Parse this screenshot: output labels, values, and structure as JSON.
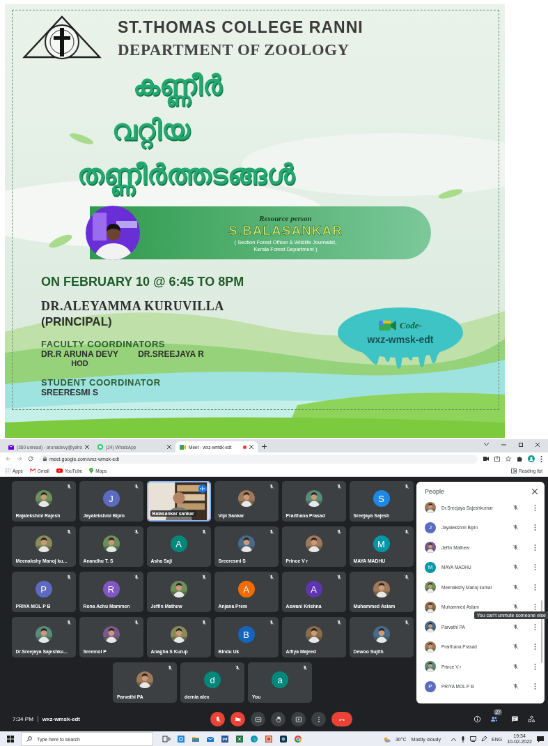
{
  "poster": {
    "college": "ST.THOMAS COLLEGE RANNI",
    "department": "DEPARTMENT OF ZOOLOGY",
    "title_lines": [
      "കണ്ണീർ",
      "വറ്റിയ",
      "തണ്ണീർത്തടങ്ങൾ"
    ],
    "resource_label": "Resource person",
    "speaker": "S.BALASANKAR",
    "speaker_role_lines": [
      "( Section Forest Officer & Wildlife Journalist,",
      "Kerala Forest Department )"
    ],
    "date": "ON FEBRUARY 10 @ 6:45 TO 8PM",
    "principal": "DR.ALEYAMMA KURUVILLA",
    "principal_role": "(PRINCIPAL)",
    "faculty_heading": "FACULTY COORDINATORS",
    "faculty": [
      {
        "name": "DR.R ARUNA DEVY",
        "role": "HOD"
      },
      {
        "name": "DR.SREEJAYA R"
      }
    ],
    "student_heading": "STUDENT COORDINATOR",
    "student": "SREERESMI S",
    "code_label": "Code-",
    "code": "wxz-wmsk-edt"
  },
  "browser": {
    "tabs": [
      {
        "kind": "mail",
        "title": "(360 unread) - arunadevy@yaho",
        "selected": false,
        "recording": false
      },
      {
        "kind": "whatsapp",
        "title": "(24) WhatsApp",
        "selected": false,
        "recording": false
      },
      {
        "kind": "meet",
        "title": "Meet - wxz-wmsk-edt",
        "selected": true,
        "recording": true
      }
    ],
    "url": "meet.google.com/wxz-wmsk-edt",
    "bookmarks": [
      {
        "kind": "apps",
        "label": "Apps"
      },
      {
        "kind": "gmail",
        "label": "Gmail"
      },
      {
        "kind": "youtube",
        "label": "YouTube"
      },
      {
        "kind": "maps",
        "label": "Maps"
      }
    ],
    "reading_list": "Reading list"
  },
  "meet": {
    "tiles": [
      {
        "name": "Rajalekshmi Rajesh",
        "muted": true,
        "speaking": false
      },
      {
        "name": "Jayalekshmi Bipin",
        "kind": "letter",
        "letter": "J",
        "color": "#5c6bc0",
        "muted": true,
        "speaking": false
      },
      {
        "name": "Balasankar sankar",
        "kind": "video",
        "muted": false,
        "speaking": true
      },
      {
        "name": "Vipi Sankar",
        "muted": true,
        "speaking": false
      },
      {
        "name": "Prarthana Prasad",
        "muted": true,
        "speaking": false
      },
      {
        "name": "Sreejaya Sajesh",
        "kind": "letter",
        "letter": "S",
        "color": "#1e88e5",
        "muted": true,
        "speaking": false
      },
      {
        "name": "Meenakshy Manoj ku...",
        "muted": true,
        "speaking": false
      },
      {
        "name": "Anandhu T. S",
        "muted": true,
        "speaking": false
      },
      {
        "name": "Asha Saji",
        "kind": "letter",
        "letter": "A",
        "color": "#00897b",
        "muted": true,
        "speaking": false
      },
      {
        "name": "Sreeresmi S",
        "muted": true,
        "speaking": false
      },
      {
        "name": "Prince V r",
        "muted": true,
        "speaking": false
      },
      {
        "name": "MAYA MADHU",
        "kind": "letter",
        "letter": "M",
        "color": "#0097a7",
        "muted": true,
        "speaking": false
      },
      {
        "name": "PRIYA MOL P B",
        "kind": "letter",
        "letter": "P",
        "color": "#5c6bc0",
        "muted": true,
        "speaking": false
      },
      {
        "name": "Rona Achu Mammen",
        "kind": "letter",
        "letter": "R",
        "color": "#7e57c2",
        "muted": true,
        "speaking": false
      },
      {
        "name": "Jeffin Mathew",
        "muted": true,
        "speaking": false
      },
      {
        "name": "Anjana Prem",
        "kind": "letter",
        "letter": "A",
        "color": "#ef6c00",
        "muted": true,
        "speaking": false
      },
      {
        "name": "Aswani Krishna",
        "kind": "letter",
        "letter": "A",
        "color": "#5e35b1",
        "muted": true,
        "speaking": false
      },
      {
        "name": "Muhammed Aslam",
        "muted": true,
        "speaking": false
      },
      {
        "name": "Dr.Sreejaya Sajeshku...",
        "muted": true,
        "speaking": false
      },
      {
        "name": "Sreemol P",
        "muted": true,
        "speaking": false
      },
      {
        "name": "Anagha S Kurup",
        "muted": true,
        "speaking": false
      },
      {
        "name": "Bindu Uk",
        "kind": "letter",
        "letter": "B",
        "color": "#1565c0",
        "muted": true,
        "speaking": false
      },
      {
        "name": "Alfiya Majeed",
        "muted": true,
        "speaking": false
      },
      {
        "name": "Dewoo Sujith",
        "muted": true,
        "speaking": false
      },
      {
        "name": "Parvathi PA",
        "muted": true,
        "speaking": false
      },
      {
        "name": "dernia alex",
        "kind": "letter",
        "letter": "d",
        "color": "#00897b",
        "muted": true,
        "speaking": false
      },
      {
        "name": "You",
        "kind": "letter",
        "letter": "a",
        "color": "#00897b",
        "muted": true,
        "speaking": false
      }
    ],
    "panel": {
      "title": "People",
      "people": [
        {
          "name": "Dr.Sreejaya Sajeshkumar"
        },
        {
          "name": "Jayalekshmi Bipin",
          "kind": "letter",
          "letter": "J",
          "color": "#5c6bc0"
        },
        {
          "name": "Jeffin Mathew"
        },
        {
          "name": "MAYA MADHU",
          "kind": "letter",
          "letter": "M",
          "color": "#0097a7"
        },
        {
          "name": "Meenakshy Manoj kumar"
        },
        {
          "name": "Muhammed Aslam",
          "tooltip": "You can't unmute someone else"
        },
        {
          "name": "Parvathi PA"
        },
        {
          "name": "Prarthana Prasad"
        },
        {
          "name": "Prince V r"
        },
        {
          "name": "PRIYA MOL P B",
          "kind": "letter",
          "letter": "P",
          "color": "#5c6bc0"
        }
      ]
    },
    "time": "7:34 PM",
    "code": "wxz-wmsk-edt",
    "controls": [
      {
        "kind": "mic",
        "on": false
      },
      {
        "kind": "camera",
        "on": false
      },
      {
        "kind": "captions",
        "on": false
      },
      {
        "kind": "hand",
        "on": false
      },
      {
        "kind": "present",
        "on": false
      },
      {
        "kind": "more",
        "on": false
      },
      {
        "kind": "end-call"
      }
    ],
    "side_buttons": [
      {
        "kind": "info",
        "selected": false
      },
      {
        "kind": "people",
        "selected": true,
        "badge": "27"
      },
      {
        "kind": "chat",
        "selected": false
      },
      {
        "kind": "activities",
        "selected": false
      }
    ]
  },
  "taskbar": {
    "search_placeholder": "Type here to search",
    "apps": [
      {
        "kind": "task-view"
      },
      {
        "kind": "store"
      },
      {
        "kind": "files"
      },
      {
        "kind": "mail"
      },
      {
        "kind": "word"
      },
      {
        "kind": "excel"
      },
      {
        "kind": "edge"
      },
      {
        "kind": "powerpoint"
      },
      {
        "kind": "camera-app"
      },
      {
        "kind": "chrome"
      }
    ],
    "weather": "30°C",
    "weather_text": "Mostly cloudy",
    "language": "ENG",
    "time": "19:34",
    "date": "10-02-2022"
  }
}
